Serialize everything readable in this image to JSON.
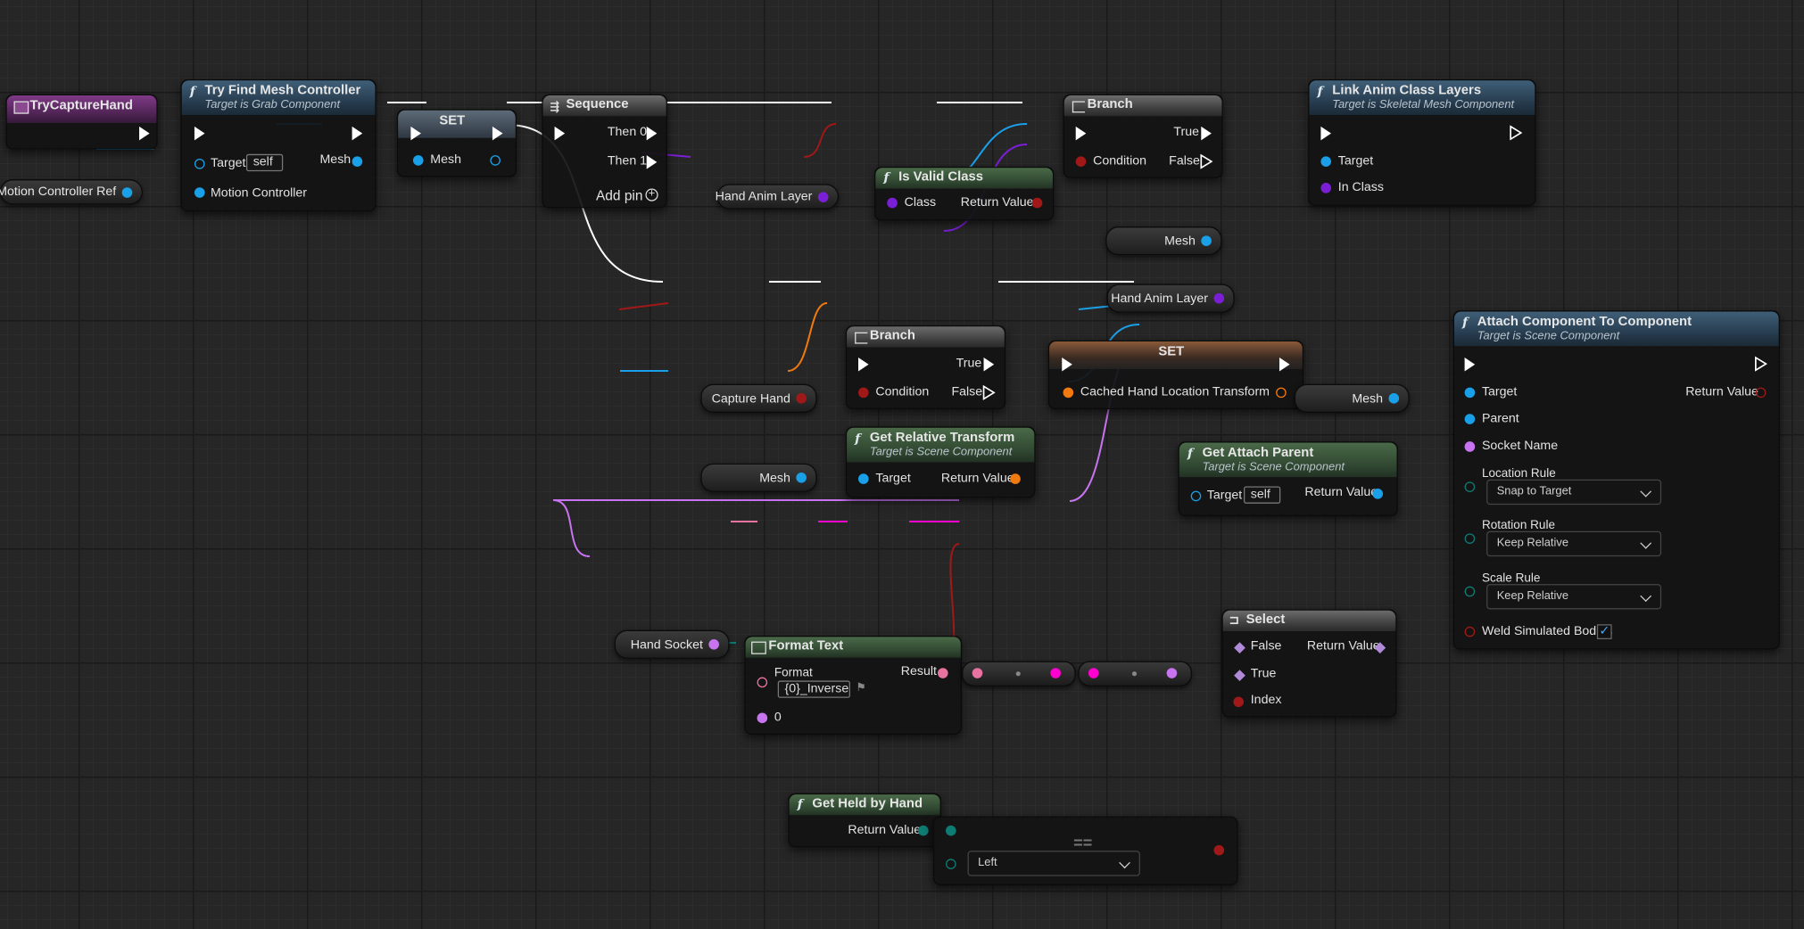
{
  "nodes": {
    "try_capture_hand": {
      "title": "TryCaptureHand"
    },
    "try_find_mesh": {
      "title": "Try Find Mesh Controller",
      "subtitle": "Target is Grab Component",
      "target_label": "Target",
      "target_value": "self",
      "mesh_label": "Mesh",
      "motion_label": "Motion Controller"
    },
    "motion_ref": {
      "label": "Motion Controller Ref"
    },
    "set_mesh": {
      "title": "SET",
      "mesh_label": "Mesh"
    },
    "sequence": {
      "title": "Sequence",
      "then0": "Then 0",
      "then1": "Then 1",
      "add_pin": "Add pin"
    },
    "branch1": {
      "title": "Branch",
      "true_label": "True",
      "false_label": "False",
      "condition_label": "Condition"
    },
    "is_valid_class": {
      "title": "Is Valid Class",
      "class_label": "Class",
      "return_label": "Return Value"
    },
    "hand_anim_layer_var1": {
      "label": "Hand Anim Layer"
    },
    "link_anim": {
      "title": "Link Anim Class Layers",
      "subtitle": "Target is Skeletal Mesh Component",
      "target_label": "Target",
      "in_class_label": "In Class"
    },
    "mesh_var_top": {
      "label": "Mesh"
    },
    "hand_anim_layer_var2": {
      "label": "Hand Anim Layer"
    },
    "branch2": {
      "title": "Branch",
      "true_label": "True",
      "false_label": "False",
      "condition_label": "Condition"
    },
    "capture_hand_var": {
      "label": "Capture Hand"
    },
    "set_cached": {
      "title": "SET",
      "field_label": "Cached Hand Location Transform"
    },
    "get_relative": {
      "title": "Get Relative Transform",
      "subtitle": "Target is Scene Component",
      "target_label": "Target",
      "return_label": "Return Value"
    },
    "mesh_var_mid": {
      "label": "Mesh"
    },
    "mesh_var_left": {
      "label": "Mesh"
    },
    "attach": {
      "title": "Attach Component To Component",
      "subtitle": "Target is Scene Component",
      "target_label": "Target",
      "parent_label": "Parent",
      "socket_label": "Socket Name",
      "return_label": "Return Value",
      "location_rule_label": "Location Rule",
      "location_rule_value": "Snap to Target",
      "rotation_rule_label": "Rotation Rule",
      "rotation_rule_value": "Keep Relative",
      "scale_rule_label": "Scale Rule",
      "scale_rule_value": "Keep Relative",
      "weld_label": "Weld Simulated Bodies",
      "weld_checked": true
    },
    "get_attach_parent": {
      "title": "Get Attach Parent",
      "subtitle": "Target is Scene Component",
      "target_label": "Target",
      "target_value": "self",
      "return_label": "Return Value"
    },
    "hand_socket_var": {
      "label": "Hand Socket"
    },
    "format_text": {
      "title": "Format Text",
      "format_label": "Format",
      "format_value": "{0}_Inverse",
      "result_label": "Result",
      "arg0_label": "0"
    },
    "select": {
      "title": "Select",
      "false_label": "False",
      "true_label": "True",
      "index_label": "Index",
      "return_label": "Return Value"
    },
    "get_held": {
      "title": "Get Held by Hand",
      "return_label": "Return Value"
    },
    "equal_node": {
      "combo_value": "Left",
      "symbol": "=="
    }
  },
  "colors": {
    "exec": "#ffffff",
    "object": "#1aa0e8",
    "class": "#7b1fd6",
    "bool": "#a01818",
    "struct": "#f07a10",
    "name": "#c873f0",
    "text": "#e873a0",
    "string": "#ff00d0",
    "enum": "#0f7c74",
    "wildcard": "#b08ad8"
  }
}
